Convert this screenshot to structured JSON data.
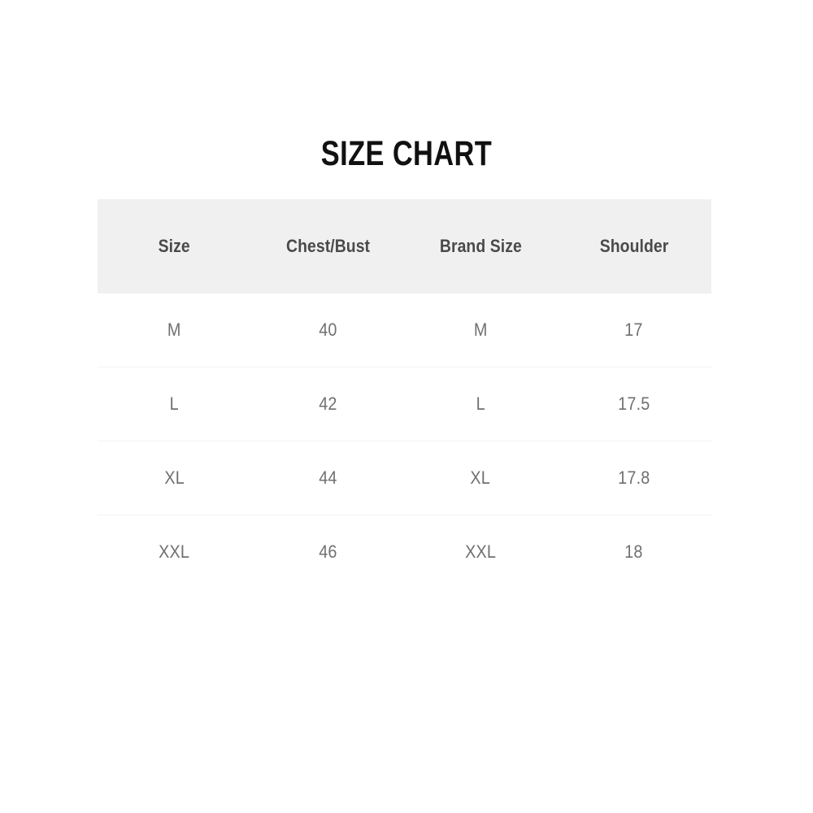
{
  "title": "SIZE CHART",
  "colors": {
    "page_background": "#ffffff",
    "header_background": "#f0f0f0",
    "title_text": "#111111",
    "header_text": "#4a4a4a",
    "body_text": "#707070",
    "row_divider": "#f3f3f3"
  },
  "chart_data": {
    "type": "table",
    "title": "SIZE CHART",
    "columns": [
      "Size",
      "Chest/Bust",
      "Brand Size",
      "Shoulder"
    ],
    "rows": [
      [
        "M",
        "40",
        "M",
        "17"
      ],
      [
        "L",
        "42",
        "L",
        "17.5"
      ],
      [
        "XL",
        "44",
        "XL",
        "17.8"
      ],
      [
        "XXL",
        "46",
        "XXL",
        "18"
      ]
    ]
  },
  "table": {
    "headers": [
      {
        "label": "Size"
      },
      {
        "label": "Chest/Bust"
      },
      {
        "label": "Brand Size"
      },
      {
        "label": "Shoulder"
      }
    ],
    "rows": [
      {
        "size": "M",
        "chest": "40",
        "brand_size": "M",
        "shoulder": "17"
      },
      {
        "size": "L",
        "chest": "42",
        "brand_size": "L",
        "shoulder": "17.5"
      },
      {
        "size": "XL",
        "chest": "44",
        "brand_size": "XL",
        "shoulder": "17.8"
      },
      {
        "size": "XXL",
        "chest": "46",
        "brand_size": "XXL",
        "shoulder": "18"
      }
    ]
  }
}
